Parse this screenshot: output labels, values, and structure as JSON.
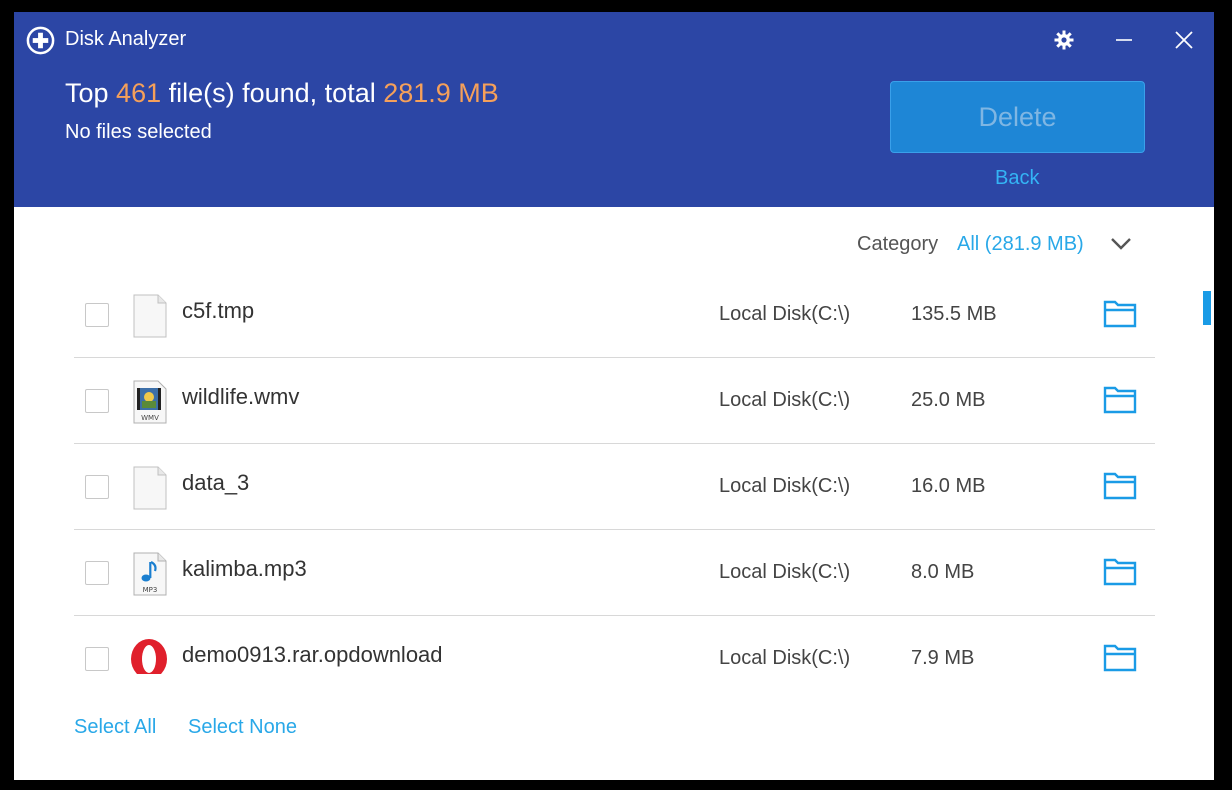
{
  "app": {
    "title": "Disk Analyzer",
    "logo_icon": "plus-circle-icon",
    "controls": [
      "gear-icon",
      "minimize-icon",
      "close-icon"
    ]
  },
  "summary": {
    "prefix": "Top ",
    "count": "461",
    "middle": " file(s) found, total ",
    "total": "281.9 MB",
    "selection": "No files selected"
  },
  "actions": {
    "delete_label": "Delete",
    "back_label": "Back"
  },
  "category": {
    "label": "Category",
    "value": "All (281.9 MB)"
  },
  "files": [
    {
      "name": "c5f.tmp",
      "location": "Local Disk(C:\\)",
      "size": "135.5 MB",
      "icon": "blank-file-icon",
      "checked": false
    },
    {
      "name": "wildlife.wmv",
      "location": "Local Disk(C:\\)",
      "size": "25.0 MB",
      "icon": "wmv-file-icon",
      "icon_text": "WMV",
      "checked": false
    },
    {
      "name": "data_3",
      "location": "Local Disk(C:\\)",
      "size": "16.0 MB",
      "icon": "blank-file-icon",
      "checked": false
    },
    {
      "name": "kalimba.mp3",
      "location": "Local Disk(C:\\)",
      "size": "8.0 MB",
      "icon": "mp3-file-icon",
      "icon_text": "MP3",
      "checked": false
    },
    {
      "name": "demo0913.rar.opdownload",
      "location": "Local Disk(C:\\)",
      "size": "7.9 MB",
      "icon": "opera-icon",
      "checked": false
    }
  ],
  "footer": {
    "select_all": "Select All",
    "select_none": "Select None"
  },
  "colors": {
    "header_bg": "#2c46a5",
    "accent_orange": "#f5a05a",
    "link_blue": "#29a8e8",
    "delete_bg": "#1e86d6",
    "scrollbar": "#1a9be6"
  }
}
